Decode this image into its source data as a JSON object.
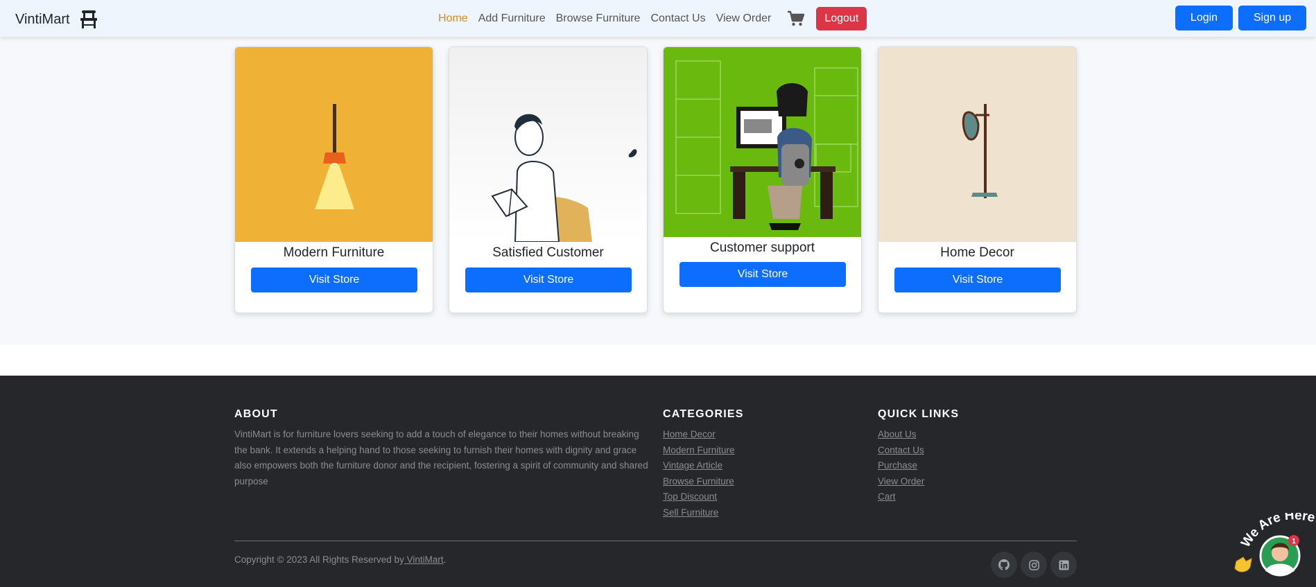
{
  "navbar": {
    "brand": "VintiMart",
    "brand_icon": "chair-icon",
    "links": [
      {
        "label": "Home",
        "active": true
      },
      {
        "label": "Add Furniture",
        "active": false
      },
      {
        "label": "Browse Furniture",
        "active": false
      },
      {
        "label": "Contact Us",
        "active": false
      },
      {
        "label": "View Order",
        "active": false
      }
    ],
    "cart_icon": "cart-icon",
    "logout_label": "Logout",
    "login_label": "Login",
    "signup_label": "Sign up"
  },
  "cards": [
    {
      "title": "Modern Furniture",
      "button": "Visit Store",
      "image": "pendant-lamp-illustration"
    },
    {
      "title": "Satisfied Customer",
      "button": "Visit Store",
      "image": "man-reading-illustration"
    },
    {
      "title": "Customer support",
      "button": "Visit Store",
      "image": "person-at-desk-illustration"
    },
    {
      "title": "Home Decor",
      "button": "Visit Store",
      "image": "floor-lamp-illustration"
    }
  ],
  "footer": {
    "about": {
      "heading": "ABOUT",
      "text": "VintiMart is for furniture lovers seeking to add a touch of elegance to their homes without breaking the bank. It extends a helping hand to those seeking to furnish their homes with dignity and grace also empowers both the furniture donor and the recipient, fostering a spirit of community and shared purpose"
    },
    "categories": {
      "heading": "CATEGORIES",
      "items": [
        "Home Decor",
        "Modern Furniture",
        "Vintage Article",
        "Browse Furniture",
        "Top Discount",
        "Sell Furniture"
      ]
    },
    "quick_links": {
      "heading": "QUICK LINKS",
      "items": [
        "About Us",
        "Contact Us",
        "Purchase",
        "View Order",
        "Cart"
      ]
    },
    "copyright_prefix": "Copyright © 2023 All Rights Reserved by",
    "copyright_link": " VintiMart",
    "copyright_suffix": ".",
    "social_icons": [
      "github-icon",
      "instagram-icon",
      "linkedin-icon"
    ]
  },
  "chat_widget": {
    "text": "We Are Here!",
    "badge": "1"
  },
  "colors": {
    "primary": "#0d6efd",
    "danger": "#dc3545",
    "active_link": "#d98a1c",
    "footer_bg": "#25272a"
  }
}
